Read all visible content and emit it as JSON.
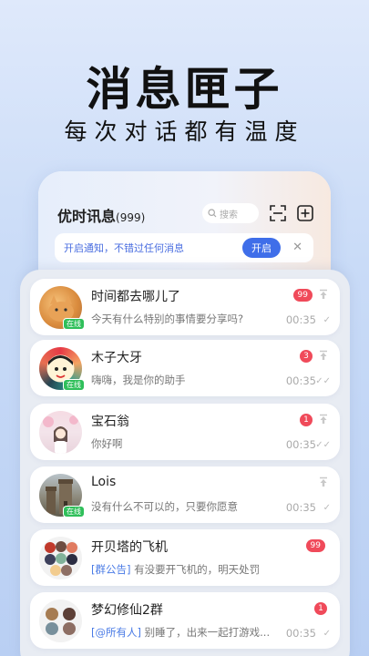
{
  "hero": {
    "title": "消息匣子",
    "subtitle": "每次对话都有温度"
  },
  "app": {
    "title": "优时讯息",
    "unread_count": "(999)",
    "search_placeholder": "搜索"
  },
  "notice": {
    "text": "开启通知，不错过任何消息",
    "button": "开启",
    "close": "✕"
  },
  "colors": {
    "accent": "#3f6ee9",
    "badge": "#f04a5a",
    "online": "#2fbf5a",
    "tag": "#4a7be6"
  },
  "conversations": [
    {
      "name": "时间都去哪儿了",
      "preview": "今天有什么特别的事情要分享吗?",
      "badge": "99",
      "time": "00:35",
      "status": "在线",
      "pinned": true,
      "check": "✓"
    },
    {
      "name": "木子大牙",
      "preview": "嗨嗨，我是你的助手",
      "badge": "3",
      "time": "00:35",
      "status": "在线",
      "pinned": true,
      "check": "✓✓"
    },
    {
      "name": "宝石翁",
      "preview": "你好啊",
      "badge": "1",
      "time": "00:35",
      "pinned": true,
      "check": "✓✓"
    },
    {
      "name": "Lois",
      "preview": "没有什么不可以的，只要你愿意",
      "time": "00:35",
      "status": "在线",
      "pinned": true,
      "check": "✓"
    },
    {
      "name": "开贝塔的飞机",
      "tag": "[群公告]",
      "preview": "有没要开飞机的，明天处罚",
      "badge": "99"
    },
    {
      "name": "梦幻修仙2群",
      "tag": "[@所有人]",
      "preview": "别睡了，出来一起打游戏...",
      "badge": "1",
      "time": "00:35",
      "check": "✓"
    }
  ]
}
